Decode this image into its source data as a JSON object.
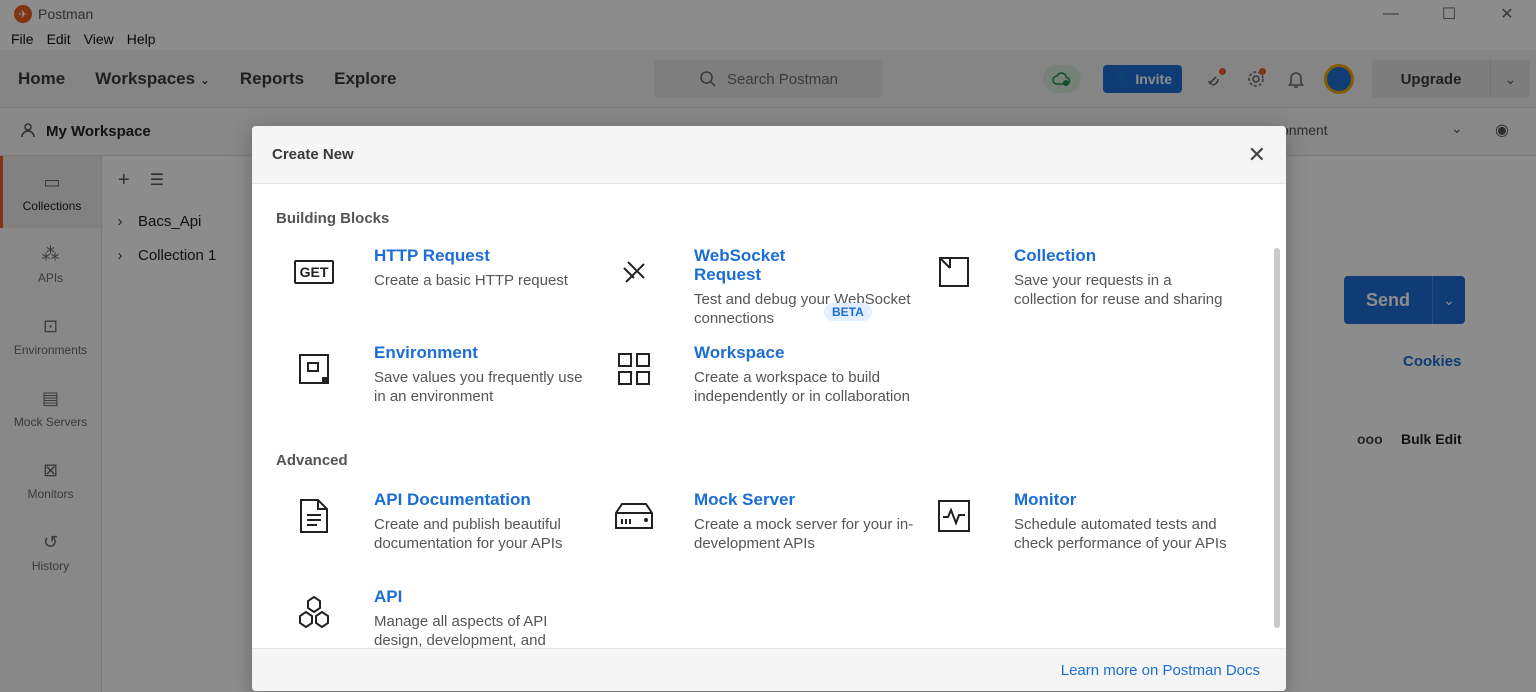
{
  "window": {
    "title": "Postman",
    "controls": [
      "—",
      "☐",
      "✕"
    ]
  },
  "menu": [
    "File",
    "Edit",
    "View",
    "Help"
  ],
  "header": {
    "nav": [
      "Home",
      "Workspaces",
      "Reports",
      "Explore"
    ],
    "search_placeholder": "Search Postman",
    "invite_label": "Invite",
    "upgrade_label": "Upgrade"
  },
  "workspace": {
    "name": "My Workspace"
  },
  "sidebar": [
    {
      "label": "Collections",
      "icon": "collections-icon"
    },
    {
      "label": "APIs",
      "icon": "apis-icon"
    },
    {
      "label": "Environments",
      "icon": "environments-icon"
    },
    {
      "label": "Mock Servers",
      "icon": "mock-servers-icon"
    },
    {
      "label": "Monitors",
      "icon": "monitors-icon"
    },
    {
      "label": "History",
      "icon": "history-icon"
    }
  ],
  "collections": [
    "Bacs_Api",
    "Collection 1"
  ],
  "workarea": {
    "env_text": "onment",
    "send_label": "Send",
    "cookies_label": "Cookies",
    "bulk_edit_label": "Bulk Edit",
    "more_label": "ooo"
  },
  "modal": {
    "title": "Create New",
    "sections": {
      "building": "Building Blocks",
      "advanced": "Advanced"
    },
    "beta_label": "BETA",
    "items": [
      {
        "title": "HTTP Request",
        "desc": "Create a basic HTTP request",
        "icon": "get-icon"
      },
      {
        "title": "WebSocket Request",
        "desc": "Test and debug your WebSocket connections",
        "icon": "websocket-icon"
      },
      {
        "title": "Collection",
        "desc": "Save your requests in a collection for reuse and sharing",
        "icon": "collection-icon"
      },
      {
        "title": "Environment",
        "desc": "Save values you frequently use in an environment",
        "icon": "environment-icon"
      },
      {
        "title": "Workspace",
        "desc": "Create a workspace to build independently or in collaboration",
        "icon": "workspace-icon"
      },
      {
        "title": "API Documentation",
        "desc": "Create and publish beautiful documentation for your APIs",
        "icon": "document-icon"
      },
      {
        "title": "Mock Server",
        "desc": "Create a mock server for your in-development APIs",
        "icon": "mock-server-icon"
      },
      {
        "title": "Monitor",
        "desc": "Schedule automated tests and check performance of your APIs",
        "icon": "monitor-icon"
      },
      {
        "title": "API",
        "desc": "Manage all aspects of API design, development, and",
        "icon": "api-icon"
      }
    ],
    "get_text": "GET",
    "footer_link": "Learn more on Postman Docs"
  }
}
